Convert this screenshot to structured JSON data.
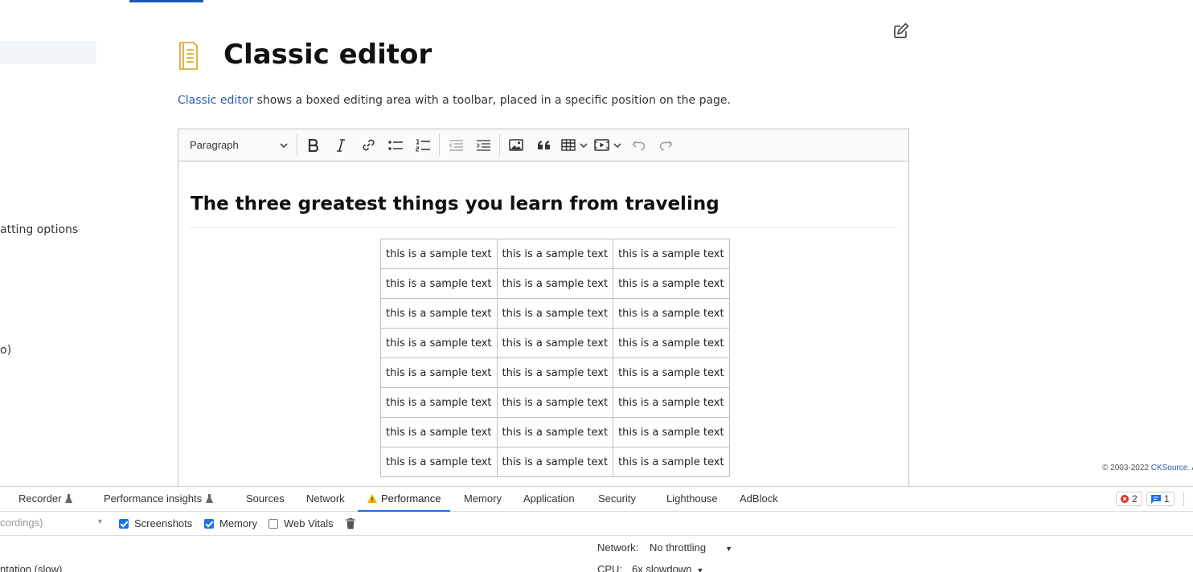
{
  "page": {
    "title": "Classic editor",
    "intro_link": "Classic editor",
    "intro_rest": " shows a boxed editing area with a toolbar, placed in a specific position on the page.",
    "sidebar_fragments": [
      "atting options",
      "o)"
    ],
    "copyright_prefix": "© 2003-2022 ",
    "copyright_brand": "CKSource.",
    "copyright_suffix": " Al"
  },
  "editor": {
    "toolbar": {
      "heading_dropdown": "Paragraph"
    },
    "heading": "The three greatest things you learn from traveling",
    "table": {
      "rows": [
        [
          "this is a sample text",
          "this is a sample text",
          "this is a sample text"
        ],
        [
          "this is a sample text",
          "this is a sample text",
          "this is a sample text"
        ],
        [
          "this is a sample text",
          "this is a sample text",
          "this is a sample text"
        ],
        [
          "this is a sample text",
          "this is a sample text",
          "this is a sample text"
        ],
        [
          "this is a sample text",
          "this is a sample text",
          "this is a sample text"
        ],
        [
          "this is a sample text",
          "this is a sample text",
          "this is a sample text"
        ],
        [
          "this is a sample text",
          "this is a sample text",
          "this is a sample text"
        ],
        [
          "this is a sample text",
          "this is a sample text",
          "this is a sample text"
        ]
      ]
    }
  },
  "devtools": {
    "tabs": [
      {
        "label": "Recorder",
        "experimental": true
      },
      {
        "label": "Performance insights",
        "experimental": true
      },
      {
        "label": "Sources"
      },
      {
        "label": "Network"
      },
      {
        "label": "Performance",
        "active": true,
        "warning": true
      },
      {
        "label": "Memory"
      },
      {
        "label": "Application"
      },
      {
        "label": "Security"
      },
      {
        "label": "Lighthouse"
      },
      {
        "label": "AdBlock"
      }
    ],
    "error_count": "2",
    "message_count": "1",
    "recordings_select": "cordings)",
    "options": {
      "screenshots": {
        "label": "Screenshots",
        "checked": true
      },
      "memory": {
        "label": "Memory",
        "checked": true
      },
      "web_vitals": {
        "label": "Web Vitals",
        "checked": false
      }
    },
    "network_label": "Network:",
    "network_value": "No throttling",
    "cpu_label": "CPU:",
    "cpu_value": "6x slowdown",
    "left_fragment": "ntation (slow)"
  },
  "colors": {
    "accent": "#1a73e8",
    "link": "#2a5ba8",
    "page_icon": "#d9a937",
    "error": "#d93025"
  }
}
